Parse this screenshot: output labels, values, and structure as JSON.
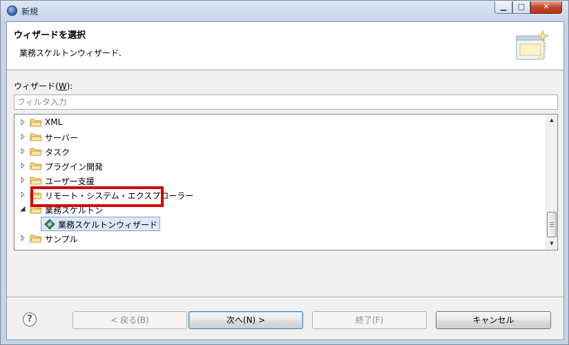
{
  "window": {
    "title": "新規",
    "min_glyph": "▁",
    "max_glyph": "□",
    "close_glyph": "✕"
  },
  "banner": {
    "title": "ウィザードを選択",
    "subtitle": "業務スケルトンウィザード."
  },
  "wizard_list": {
    "label_prefix": "ウィザード(",
    "label_mnemonic": "W",
    "label_suffix": "):",
    "filter_placeholder": "フィルタ入力",
    "filter_value": ""
  },
  "tree": {
    "items": [
      {
        "label": "XML",
        "expanded": false
      },
      {
        "label": "サーバー",
        "expanded": false
      },
      {
        "label": "タスク",
        "expanded": false
      },
      {
        "label": "プラグイン開発",
        "expanded": false
      },
      {
        "label": "ユーザー支援",
        "expanded": false
      },
      {
        "label": "リモート・システム・エクスプローラー",
        "expanded": false
      },
      {
        "label": "業務スケルトン",
        "expanded": true
      },
      {
        "label": "サンプル",
        "expanded": false
      }
    ],
    "selected_child": "業務スケルトンウィザード",
    "scroll_up_glyph": "▲",
    "scroll_down_glyph": "▼"
  },
  "buttons": {
    "help_glyph": "?",
    "back_label": "< 戻る(B)",
    "next_label": "次へ(N) >",
    "finish_label": "終了(F)",
    "cancel_label": "キャンセル"
  },
  "colors": {
    "highlight_border": "#d60000",
    "selection_bg": "#dbe7f6",
    "folder_fill": "#f6d78b"
  }
}
